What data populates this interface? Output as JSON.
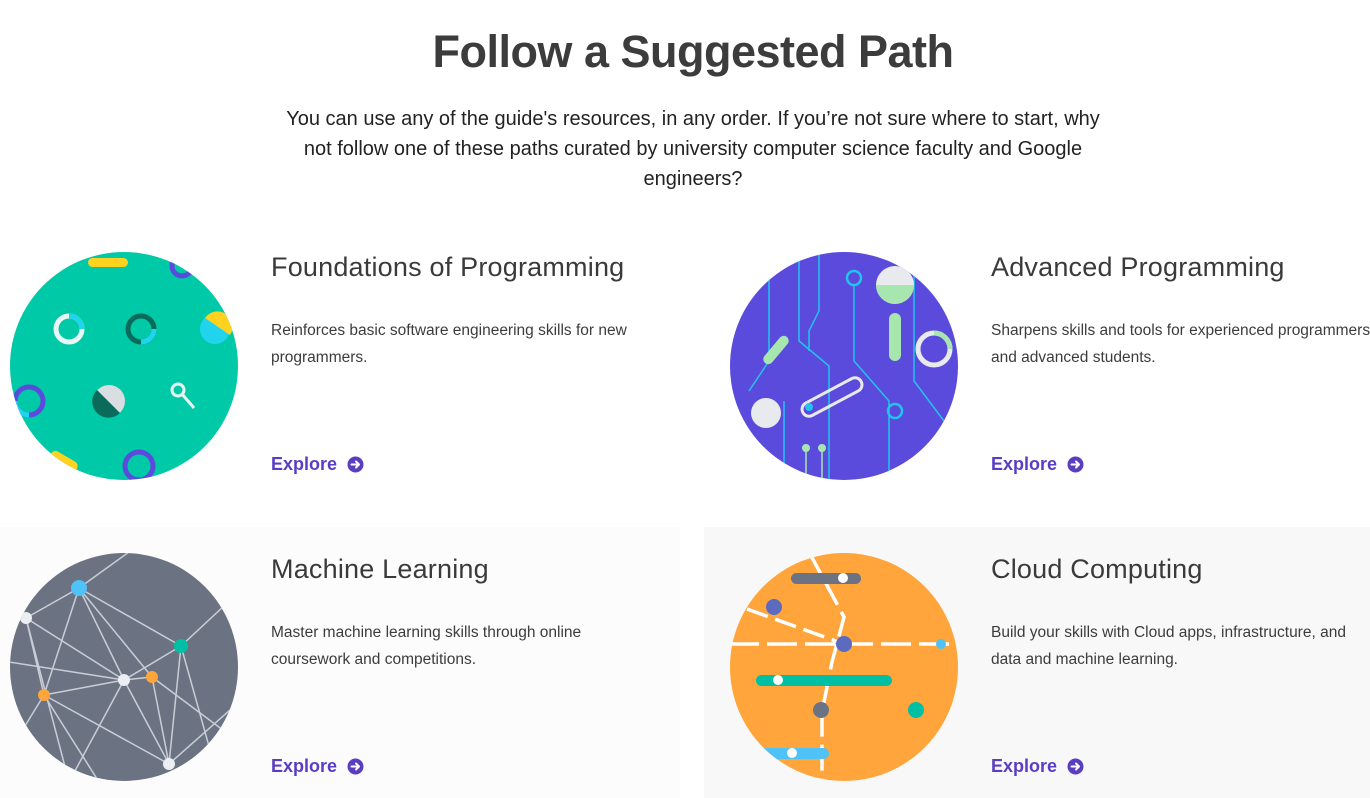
{
  "header": {
    "title": "Follow a Suggested Path",
    "intro": "You can use any of the guide's resources, in any order. If you’re not sure where to start, why not follow one of these paths curated by university computer science faculty and Google engineers?"
  },
  "accent_color": "#5b3cc4",
  "paths": [
    {
      "title": "Foundations of Programming",
      "description": "Reinforces basic software engineering skills for new programmers.",
      "cta": "Explore",
      "illustration_color": "#00c9a7"
    },
    {
      "title": "Advanced Programming",
      "description": "Sharpens skills and tools for experienced programmers and advanced students.",
      "cta": "Explore",
      "illustration_color": "#5a4bdc"
    },
    {
      "title": "Machine Learning",
      "description": "Master machine learning skills through online coursework and competitions.",
      "cta": "Explore",
      "illustration_color": "#6b7383"
    },
    {
      "title": "Cloud Computing",
      "description": "Build your skills with Cloud apps, infrastructure, and data and machine learning.",
      "cta": "Explore",
      "illustration_color": "#ffa53c"
    }
  ]
}
